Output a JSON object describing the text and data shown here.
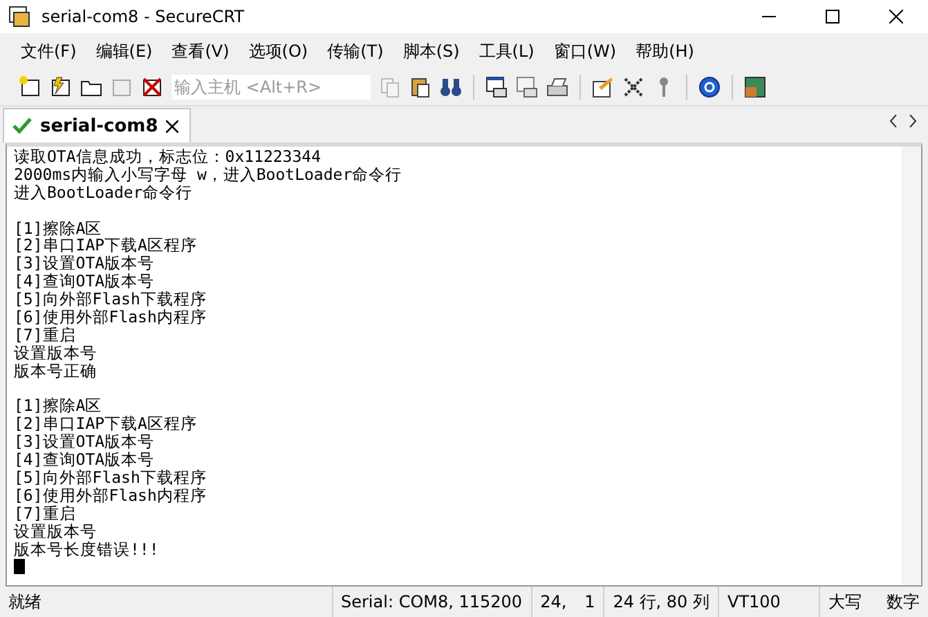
{
  "window": {
    "title": "serial-com8 - SecureCRT"
  },
  "menu": [
    "文件(F)",
    "编辑(E)",
    "查看(V)",
    "选项(O)",
    "传输(T)",
    "脚本(S)",
    "工具(L)",
    "窗口(W)",
    "帮助(H)"
  ],
  "toolbar": {
    "host_field": {
      "placeholder": "输入主机 <Alt+R>"
    }
  },
  "tabs": [
    {
      "label": "serial-com8",
      "selected": true,
      "connected": true
    }
  ],
  "terminal": {
    "blocks": [
      [
        "读取OTA信息成功，标志位：0x11223344",
        "2000ms内输入小写字母 w，进入BootLoader命令行",
        "进入BootLoader命令行"
      ],
      [
        "[1]擦除A区",
        "[2]串口IAP下载A区程序",
        "[3]设置OTA版本号",
        "[4]查询OTA版本号",
        "[5]向外部Flash下载程序",
        "[6]使用外部Flash内程序",
        "[7]重启",
        "设置版本号",
        "版本号正确"
      ],
      [
        "[1]擦除A区",
        "[2]串口IAP下载A区程序",
        "[3]设置OTA版本号",
        "[4]查询OTA版本号",
        "[5]向外部Flash下载程序",
        "[6]使用外部Flash内程序",
        "[7]重启",
        "设置版本号",
        "版本号长度错误!!!"
      ]
    ]
  },
  "status_bar": [
    "就绪",
    "Serial: COM8, 115200",
    "24,",
    "1",
    "24 行, 80 列",
    "VT100",
    "大写",
    "数字"
  ]
}
